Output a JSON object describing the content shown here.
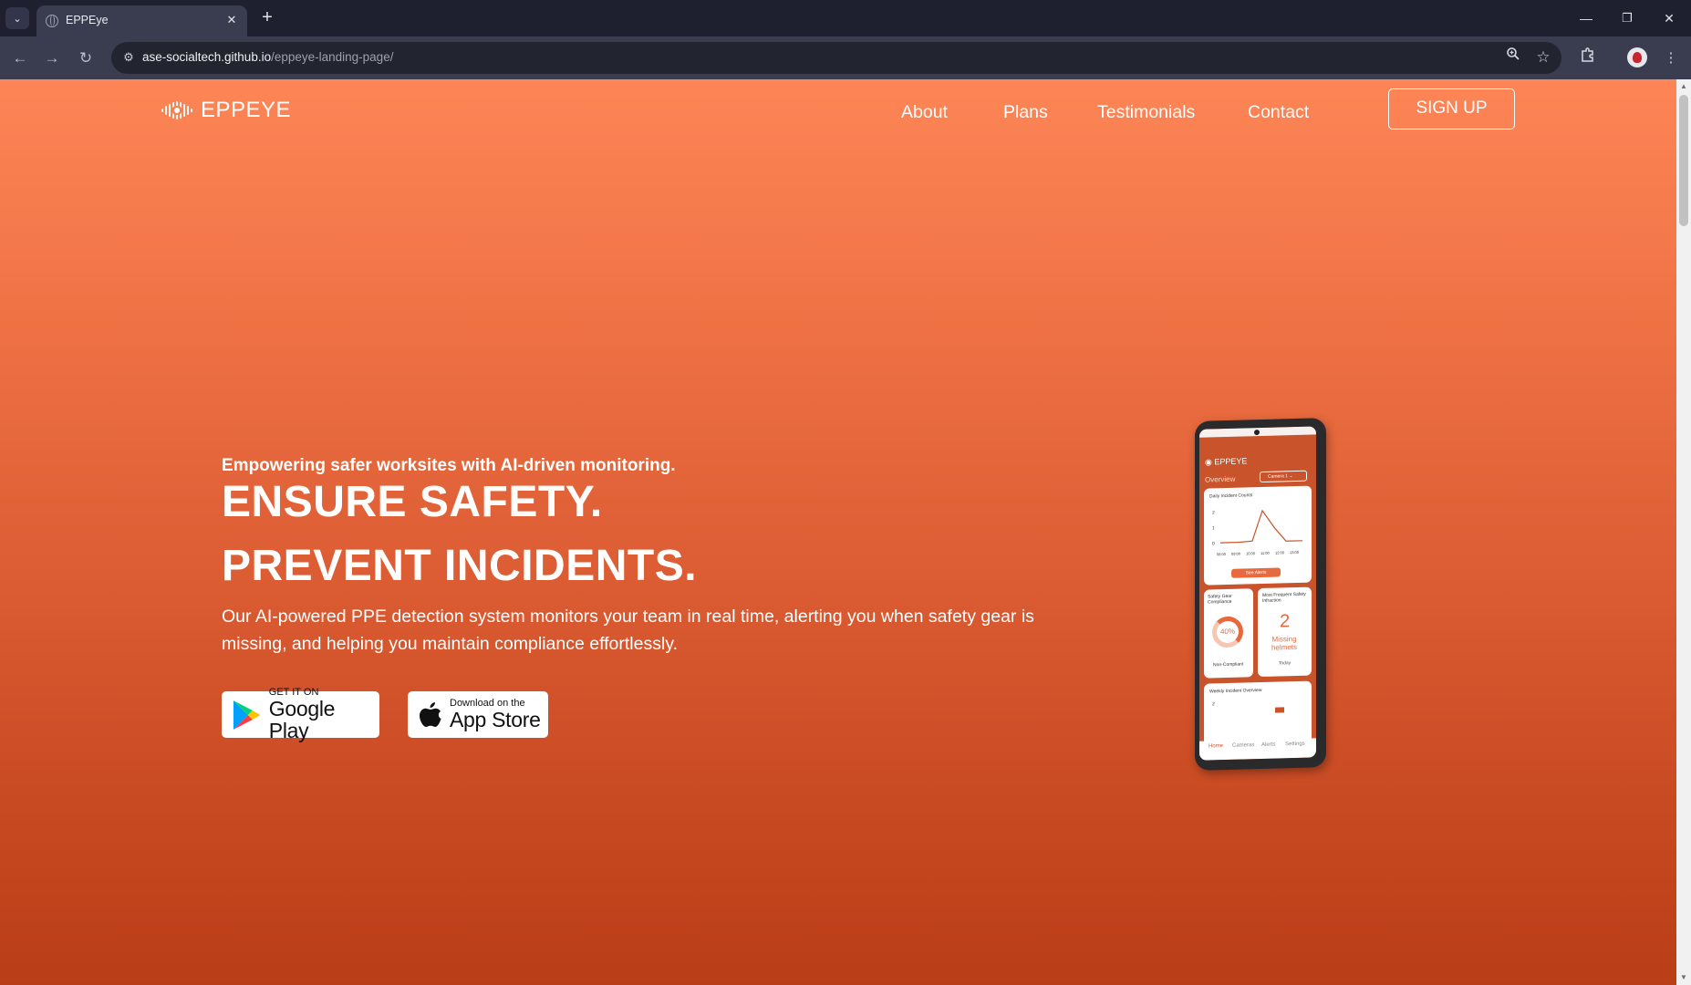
{
  "browser": {
    "tab_title": "EPPEye",
    "url_domain": "ase-socialtech.github.io",
    "url_path": "/eppeye-landing-page/",
    "icons": [
      "tab-list-icon",
      "close-icon",
      "plus-icon",
      "minimize-icon",
      "restore-icon",
      "close-window-icon",
      "back-icon",
      "forward-icon",
      "reload-icon",
      "site-info-icon",
      "zoom-icon",
      "star-icon",
      "extensions-icon",
      "avatar",
      "more-icon"
    ]
  },
  "header": {
    "logo_text": "EPPEYE",
    "nav": [
      "About",
      "Plans",
      "Testimonials",
      "Contact"
    ],
    "signup_label": "SIGN UP"
  },
  "hero": {
    "tagline": "Empowering safer worksites with AI-driven monitoring.",
    "headline_1": "ENSURE SAFETY.",
    "headline_2": "PREVENT INCIDENTS.",
    "description": "Our AI-powered PPE detection system monitors your team in real time, alerting you when safety gear is missing, and helping you maintain compliance effortlessly.",
    "google_play": {
      "small": "GET IT ON",
      "big": "Google Play"
    },
    "app_store": {
      "small": "Download on the",
      "big": "App Store"
    }
  },
  "phone": {
    "logo": "EPPEYE",
    "overview": "Overview",
    "camera_select": "Camera 1",
    "daily_title": "Daily Incident Counts",
    "y_ticks": [
      "2",
      "1",
      "0"
    ],
    "x_ticks": [
      "08:00",
      "09:00",
      "10:00",
      "11:00",
      "12:00",
      "13:00"
    ],
    "see_alerts": "See Alerts",
    "gear_title": "Safety Gear Compliance",
    "gear_percent": "40%",
    "gear_label": "Non-Compliant",
    "infraction_title": "Most Frequent Safety Infraction",
    "infraction_count": "2",
    "infraction_label": "Missing helmets",
    "infraction_period": "Today",
    "weekly_title": "Weekly Incident Overview",
    "weekly_tick": "2",
    "bottom_nav": [
      "Home",
      "Cameras",
      "Alerts",
      "Settings"
    ]
  },
  "colors": {
    "gradient_top": "#fd8556",
    "gradient_bottom": "#b93d17",
    "accent": "#e8693d"
  }
}
